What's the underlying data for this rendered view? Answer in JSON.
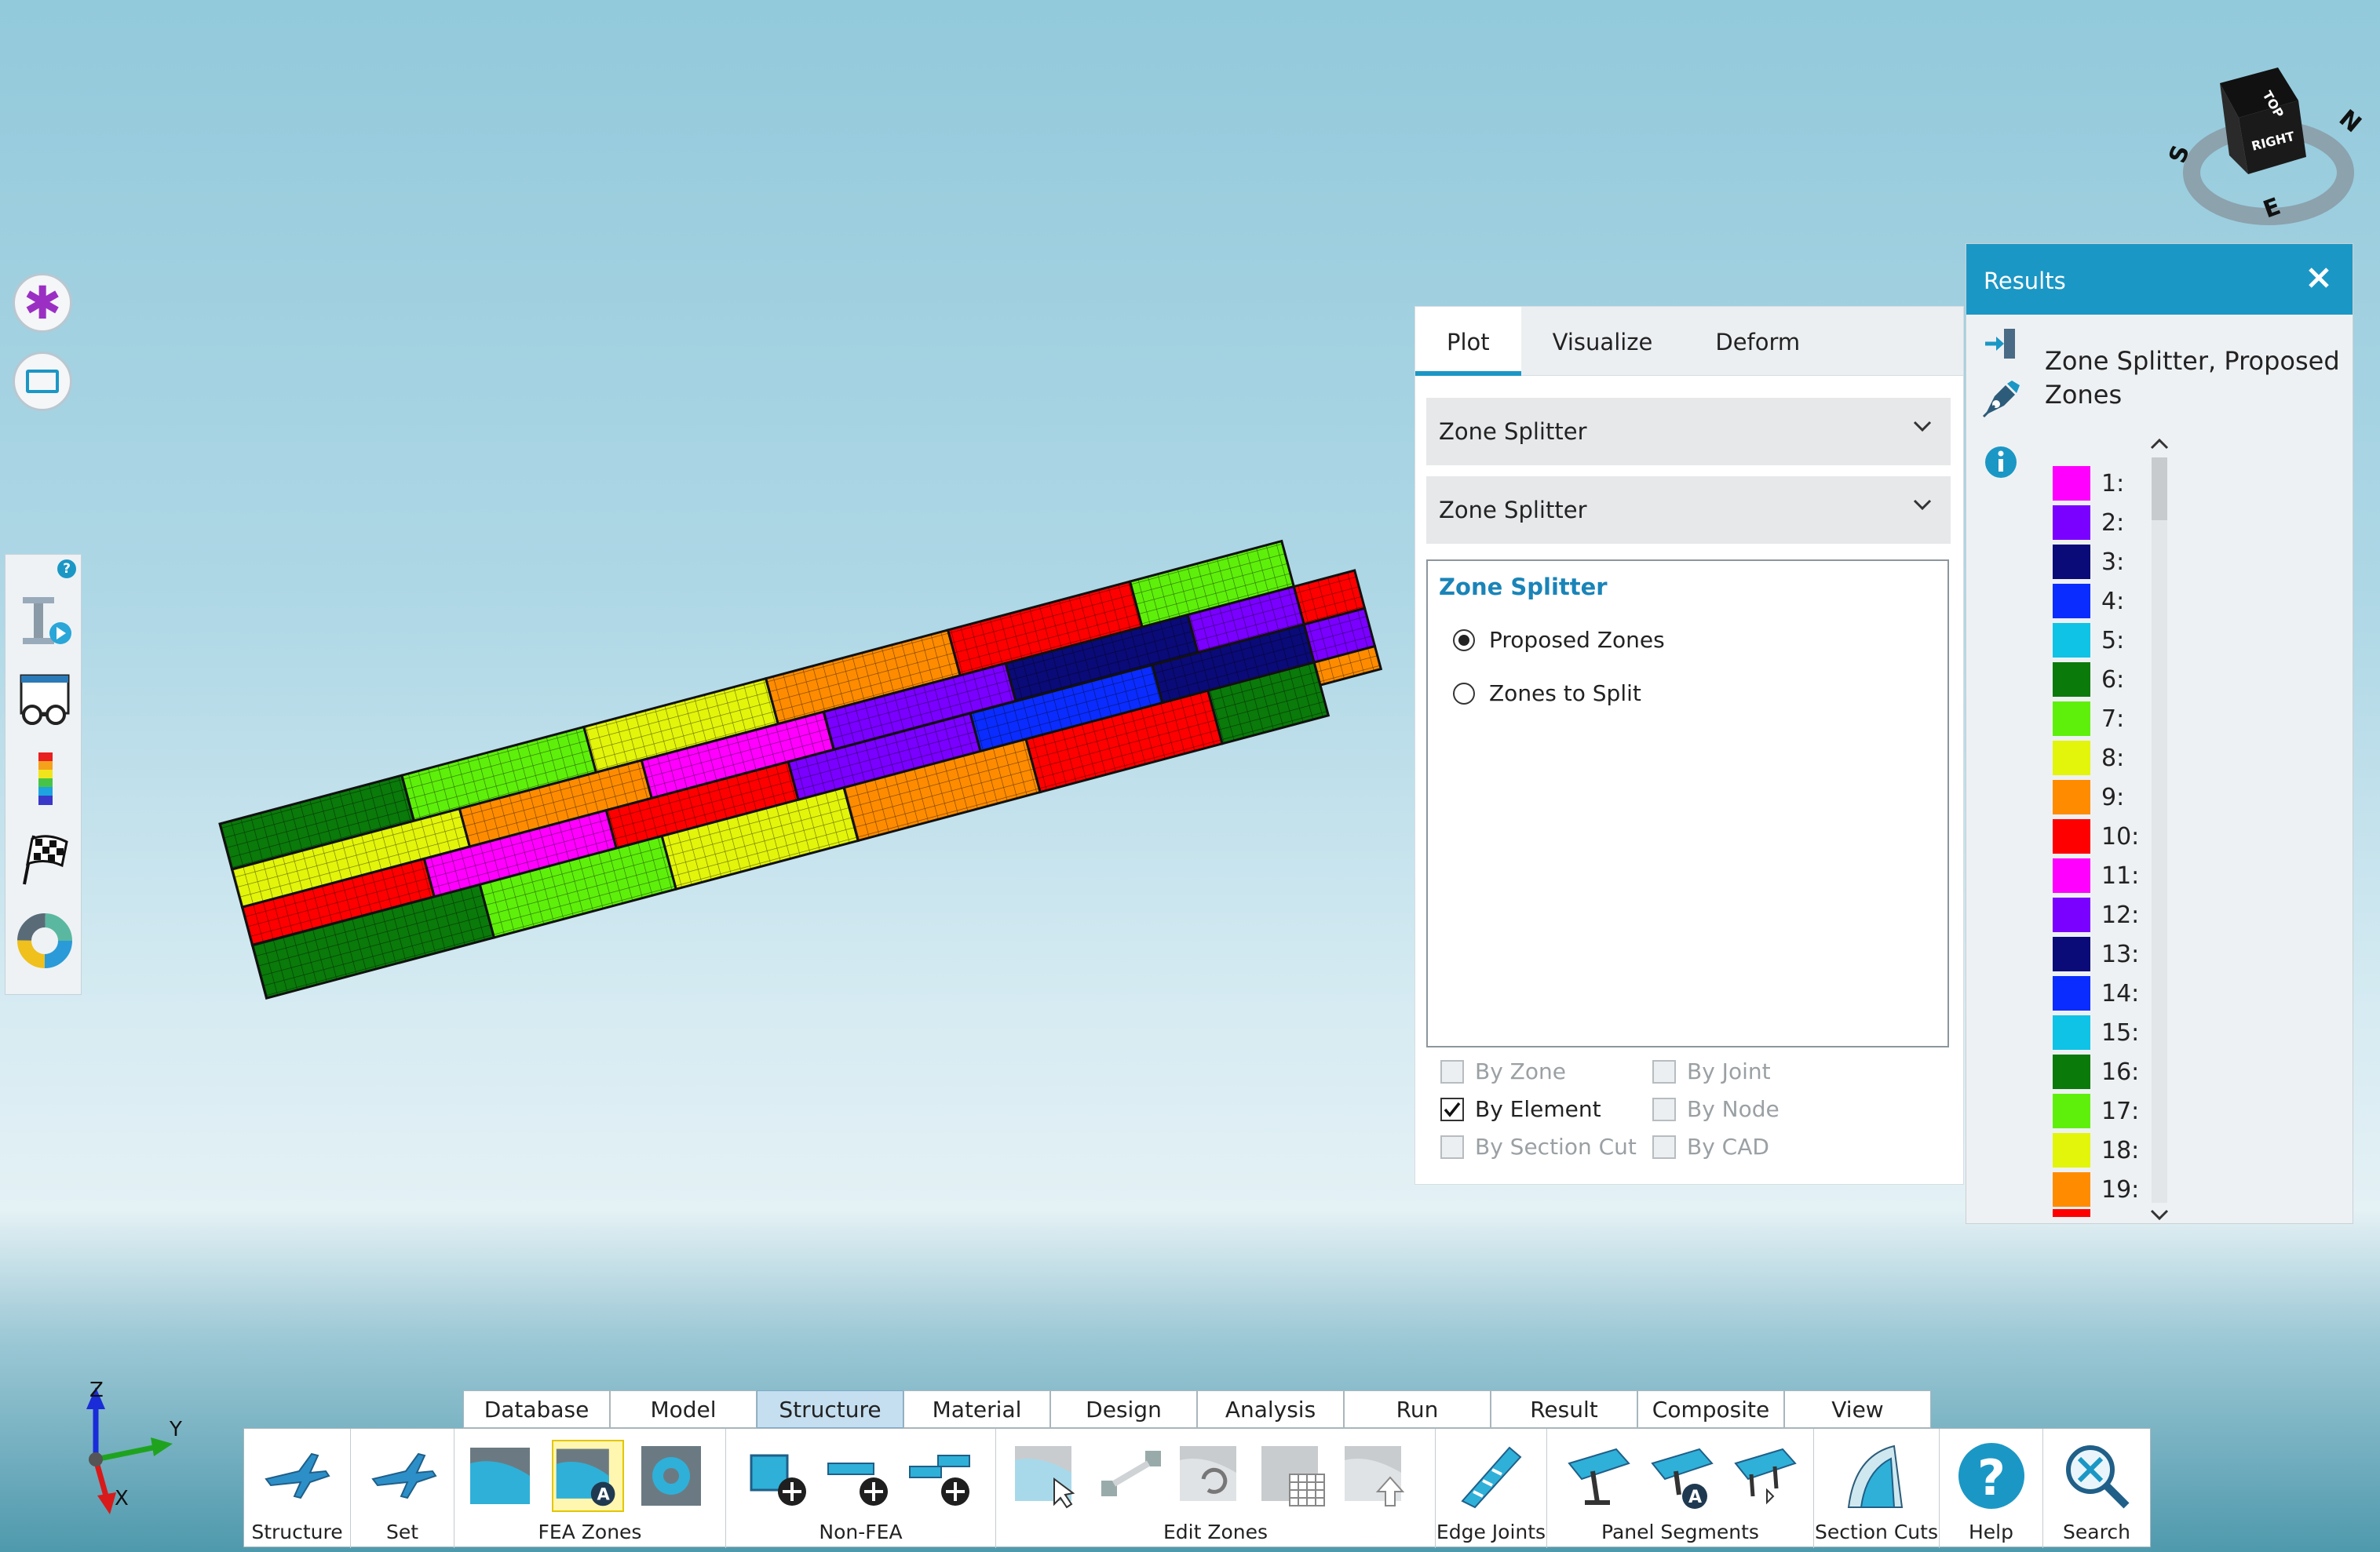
{
  "colors": {
    "accent": "#1b97c5",
    "zones": [
      "#ff00ff",
      "#7a00ff",
      "#0a0a78",
      "#0a2cff",
      "#0fc3e6",
      "#0a7a0a",
      "#5ef00a",
      "#e3f50a",
      "#ff8c00",
      "#ff0000",
      "#ff00ff",
      "#7a00ff",
      "#0a0a78",
      "#0a2cff",
      "#0fc3e6",
      "#0a7a0a",
      "#5ef00a",
      "#e3f50a",
      "#ff8c00"
    ]
  },
  "navcube": {
    "face_top": "TOP",
    "face_right": "RIGHT",
    "compass_n": "N",
    "compass_s": "S",
    "compass_e": "E"
  },
  "left_tools": {
    "icons": [
      "asterisk-icon",
      "rectangle-select-icon"
    ]
  },
  "plot_panel": {
    "tabs": [
      {
        "label": "Plot",
        "active": true
      },
      {
        "label": "Visualize"
      },
      {
        "label": "Deform"
      }
    ],
    "dropdown1": "Zone Splitter",
    "dropdown2": "Zone Splitter",
    "group_title": "Zone Splitter",
    "radios": [
      {
        "label": "Proposed Zones",
        "checked": true
      },
      {
        "label": "Zones to Split",
        "checked": false
      }
    ],
    "checks": {
      "by_zone": "By Zone",
      "by_joint": "By Joint",
      "by_element": "By Element",
      "by_node": "By Node",
      "by_section_cut": "By Section Cut",
      "by_cad": "By CAD"
    }
  },
  "results": {
    "title": "Results",
    "heading": "Zone Splitter, Proposed Zones",
    "legend": [
      "1:",
      "2:",
      "3:",
      "4:",
      "5:",
      "6:",
      "7:",
      "8:",
      "9:",
      "10:",
      "11:",
      "12:",
      "13:",
      "14:",
      "15:",
      "16:",
      "17:",
      "18:",
      "19:"
    ]
  },
  "axis": {
    "z": "Z",
    "y": "Y",
    "x": "X"
  },
  "ribbon": {
    "tabs": [
      "Database",
      "Model",
      "Structure",
      "Material",
      "Design",
      "Analysis",
      "Run",
      "Result",
      "Composite",
      "View"
    ],
    "active_tab": "Structure",
    "btn_structure": "Structure",
    "btn_set": "Set",
    "grp_fea_zones": "FEA Zones",
    "grp_non_fea": "Non-FEA",
    "grp_edit_zones": "Edit Zones",
    "grp_edge_joints": "Edge Joints",
    "grp_panel_segments": "Panel Segments",
    "grp_section_cuts": "Section Cuts",
    "btn_help": "Help",
    "btn_search": "Search"
  }
}
